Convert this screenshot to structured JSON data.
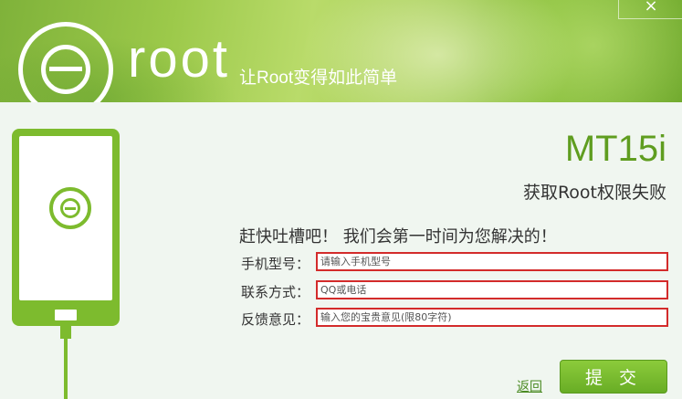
{
  "header": {
    "brand": "root",
    "slogan": "让Root变得如此简单",
    "close_label": "×"
  },
  "device": {
    "model": "MT15i",
    "status": "获取Root权限失败"
  },
  "feedback": {
    "prompt": "赶快吐槽吧！ 我们会第一时间为您解决的！",
    "fields": [
      {
        "label": "手机型号：",
        "placeholder": "请输入手机型号"
      },
      {
        "label": "联系方式：",
        "placeholder": "QQ或电话"
      },
      {
        "label": "反馈意见：",
        "placeholder": "输入您的宝贵意见(限80字符)"
      }
    ]
  },
  "actions": {
    "back": "返回",
    "submit": "提 交"
  },
  "colors": {
    "accent": "#7dbb2e",
    "field_border": "#d32b2b"
  }
}
